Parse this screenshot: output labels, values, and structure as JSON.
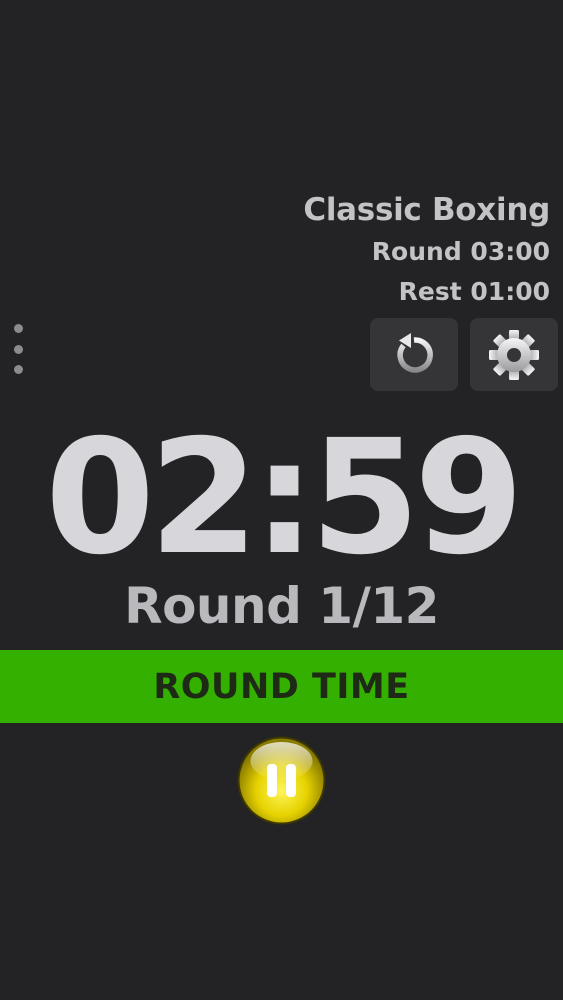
{
  "preset": {
    "name": "Classic Boxing",
    "round_info": "Round 03:00",
    "rest_info": "Rest 01:00"
  },
  "timer": {
    "display": "02:59"
  },
  "round": {
    "label": "Round 1/12"
  },
  "phase": {
    "label": "ROUND TIME",
    "color": "#33b000"
  },
  "controls": {
    "reset_icon": "reset-icon",
    "settings_icon": "gear-icon",
    "menu_icon": "overflow-menu-icon",
    "pause_icon": "pause-icon",
    "pause_color": "#f2e400"
  },
  "theme": {
    "background": "#232224",
    "text": "#d7d6da"
  }
}
